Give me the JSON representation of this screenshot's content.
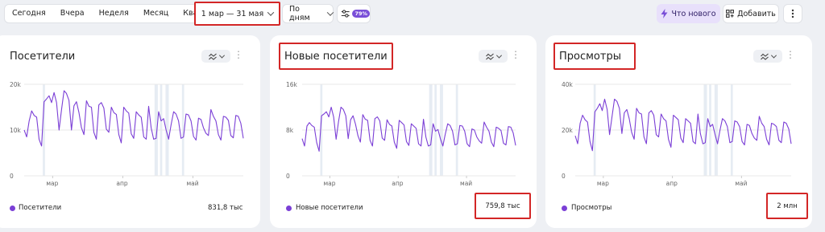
{
  "toolbar": {
    "periods": [
      "Сегодня",
      "Вчера",
      "Неделя",
      "Месяц",
      "Квартал"
    ],
    "date_range": "1 мар — 31 мая",
    "grouping": "По дням",
    "filter_badge": "79%",
    "whats_new": "Что нового",
    "add": "Добавить"
  },
  "colors": {
    "accent": "#7b3fd6",
    "highlight_box": "#d32626",
    "news_bg": "#e8e0fb"
  },
  "cards": [
    {
      "title": "Посетители",
      "legend": "Посетители",
      "total": "831,8 тыс",
      "chart_data": {
        "type": "line",
        "y_ticks": [
          "20k",
          "10k",
          "0"
        ],
        "ylim": [
          0,
          20000
        ],
        "x_ticks": [
          "мар",
          "апр",
          "май"
        ],
        "grid": true,
        "series": [
          {
            "name": "Посетители",
            "values": [
              10000,
              8500,
              12000,
              14200,
              13200,
              12800,
              8000,
              6500,
              16200,
              16800,
              17500,
              16000,
              18200,
              16000,
              10000,
              14500,
              18600,
              18000,
              16500,
              10000,
              15300,
              16200,
              13800,
              10500,
              9000,
              16400,
              15200,
              15000,
              9500,
              8000,
              15500,
              16000,
              14800,
              10200,
              9500,
              15000,
              13800,
              13400,
              9000,
              7200,
              15000,
              14200,
              13700,
              9200,
              8200,
              14000,
              13300,
              12800,
              8500,
              8000,
              15200,
              10500,
              8000,
              8200,
              14000,
              12000,
              12500,
              10000,
              8000,
              11200,
              14000,
              13500,
              12000,
              8200,
              8500,
              13500,
              13300,
              12000,
              8600,
              7800,
              12600,
              12300,
              10500,
              9300,
              8800,
              14500,
              13000,
              12000,
              9000,
              7800,
              13000,
              12800,
              12100,
              8800,
              8300,
              13200,
              13000,
              11500,
              8200
            ]
          }
        ]
      }
    },
    {
      "title": "Новые посетители",
      "legend": "Новые посетители",
      "total": "759,8 тыс",
      "chart_data": {
        "type": "line",
        "y_ticks": [
          "16k",
          "8k",
          "0"
        ],
        "ylim": [
          0,
          16000
        ],
        "x_ticks": [
          "мар",
          "апр",
          "май"
        ],
        "grid": true,
        "series": [
          {
            "name": "Новые посетители",
            "values": [
              6500,
              5200,
              8700,
              9300,
              8800,
              8500,
              5800,
              4300,
              10500,
              10800,
              11200,
              10300,
              12000,
              10300,
              6400,
              9500,
              12000,
              11600,
              10500,
              6500,
              9800,
              10500,
              9000,
              7000,
              5900,
              10700,
              9900,
              9700,
              6200,
              5200,
              10000,
              10300,
              9600,
              6600,
              6200,
              9800,
              9000,
              8700,
              5900,
              4800,
              9700,
              9300,
              8900,
              6000,
              5300,
              9100,
              8700,
              8300,
              5600,
              5200,
              9900,
              6800,
              5200,
              5400,
              9100,
              7800,
              8100,
              6500,
              5200,
              7300,
              9100,
              8800,
              7800,
              5400,
              5600,
              8800,
              8700,
              7800,
              5600,
              5100,
              8200,
              8000,
              6800,
              6100,
              5700,
              9400,
              8500,
              7800,
              5900,
              5100,
              8500,
              8300,
              7900,
              5700,
              5400,
              8600,
              8500,
              7500,
              5300
            ]
          }
        ]
      }
    },
    {
      "title": "Просмотры",
      "legend": "Просмотры",
      "total": "2 млн",
      "chart_data": {
        "type": "line",
        "y_ticks": [
          "40k",
          "20k",
          "0"
        ],
        "ylim": [
          0,
          40000
        ],
        "x_ticks": [
          "мар",
          "апр",
          "май"
        ],
        "grid": true,
        "series": [
          {
            "name": "Просмотры",
            "values": [
              17500,
              14000,
              23000,
              26500,
              24500,
              23500,
              15000,
              11000,
              28000,
              29500,
              31500,
              28500,
              33500,
              29000,
              18000,
              26000,
              33500,
              32500,
              29500,
              18500,
              27500,
              29000,
              25000,
              19000,
              16000,
              29500,
              27500,
              27000,
              17000,
              14000,
              27500,
              28500,
              26500,
              18000,
              17000,
              27000,
              25000,
              24000,
              16000,
              12500,
              26500,
              25500,
              24500,
              16500,
              14500,
              25000,
              24000,
              23000,
              15000,
              14000,
              27000,
              18500,
              14000,
              14500,
              25000,
              21500,
              22500,
              18000,
              14000,
              20000,
              25000,
              24000,
              21500,
              14500,
              15000,
              24000,
              23500,
              21500,
              15000,
              13500,
              22500,
              22000,
              18500,
              16500,
              15500,
              26000,
              23000,
              21500,
              16000,
              13500,
              23000,
              22500,
              21500,
              15500,
              14500,
              23500,
              23000,
              20500,
              14000
            ]
          }
        ]
      }
    }
  ]
}
